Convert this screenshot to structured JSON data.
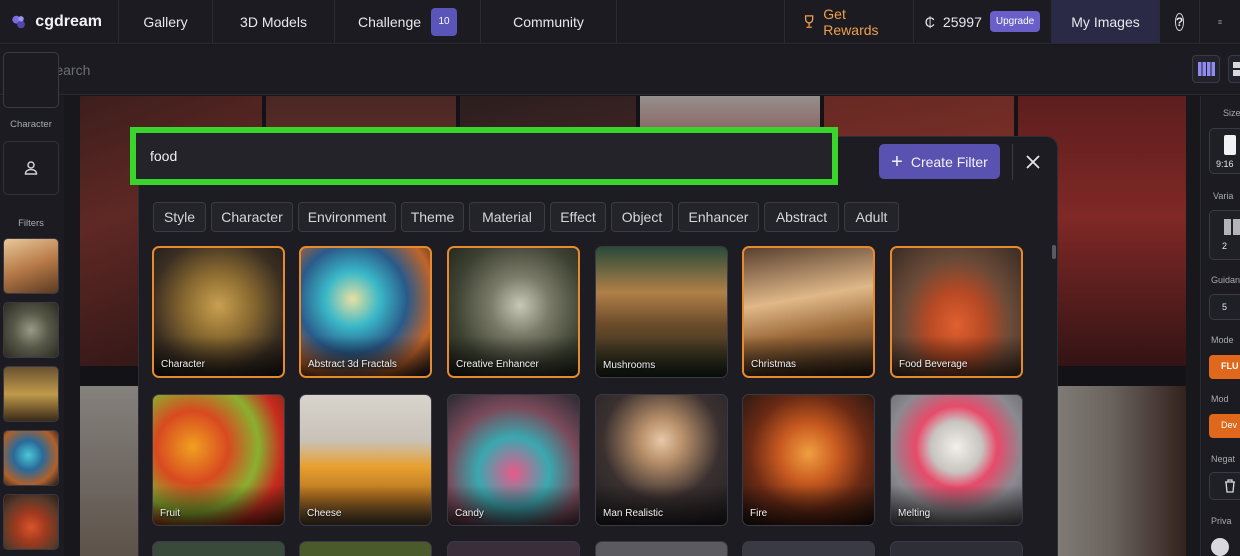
{
  "app": {
    "name": "cgdream"
  },
  "nav": {
    "gallery": "Gallery",
    "models_3d": "3D Models",
    "challenge": "Challenge",
    "challenge_badge": "10",
    "community": "Community",
    "rewards": "Get Rewards",
    "credits": "25997",
    "upgrade": "Upgrade",
    "my_images": "My Images",
    "help_glyph": "?"
  },
  "search": {
    "placeholder": "Search"
  },
  "left_sidebar": {
    "character_label": "Character",
    "filters_label": "Filters"
  },
  "right_sidebar": {
    "size_label": "Size",
    "size_value": "9:16",
    "variations_label": "Varia",
    "variations_value": "2",
    "guidance_label": "Guidan",
    "guidance_value": "5",
    "model_label": "Mode",
    "model_value": "FLU",
    "mode_label": "Mod",
    "mode_value": "Dev",
    "negative_label": "Negat",
    "privacy_label": "Priva"
  },
  "modal": {
    "filter_value": "food",
    "create_filter": "Create Filter",
    "tabs": [
      "Style",
      "Character",
      "Environment",
      "Theme",
      "Material",
      "Effect",
      "Object",
      "Enhancer",
      "Abstract",
      "Adult"
    ],
    "cards": [
      {
        "label": "Character",
        "selected": true
      },
      {
        "label": "Abstract 3d Fractals",
        "selected": true
      },
      {
        "label": "Creative Enhancer",
        "selected": true
      },
      {
        "label": "Mushrooms",
        "selected": false
      },
      {
        "label": "Christmas",
        "selected": true
      },
      {
        "label": "Food Beverage",
        "selected": true
      },
      {
        "label": "Fruit",
        "selected": false
      },
      {
        "label": "Cheese",
        "selected": false
      },
      {
        "label": "Candy",
        "selected": false
      },
      {
        "label": "Man Realistic",
        "selected": false
      },
      {
        "label": "Fire",
        "selected": false
      },
      {
        "label": "Melting",
        "selected": false
      }
    ]
  },
  "colors": {
    "accent": "#5a52b0",
    "highlight": "#39d42c",
    "selected_border": "#e58a2e",
    "rewards": "#f0a04a"
  },
  "icons": [
    "logo-icon",
    "trophy-icon",
    "credit-icon",
    "help-icon",
    "menu-icon",
    "search-icon",
    "grid-view-icon",
    "list-view-icon",
    "person-icon",
    "plus-icon",
    "close-icon",
    "trash-icon"
  ]
}
